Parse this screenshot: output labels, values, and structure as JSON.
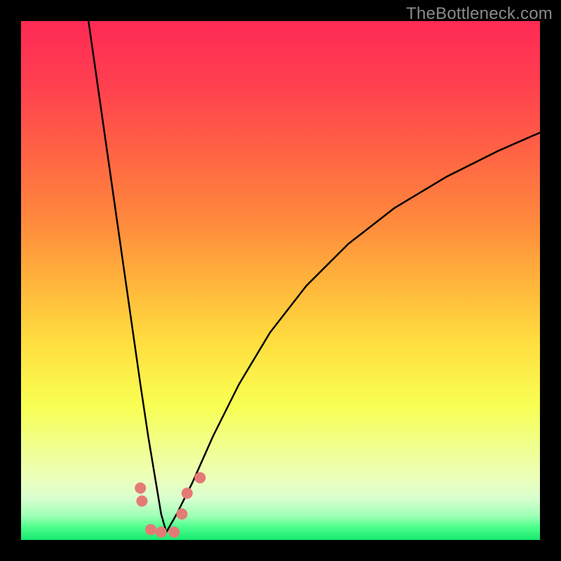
{
  "watermark": "TheBottleneck.com",
  "colors": {
    "black": "#000000",
    "curve": "#000000",
    "dot": "#e47a76",
    "gradient_stops": [
      {
        "offset": 0.0,
        "color": "#ff2a55"
      },
      {
        "offset": 0.12,
        "color": "#ff3f4f"
      },
      {
        "offset": 0.25,
        "color": "#ff6244"
      },
      {
        "offset": 0.38,
        "color": "#ff873d"
      },
      {
        "offset": 0.5,
        "color": "#ffb33b"
      },
      {
        "offset": 0.62,
        "color": "#ffde3f"
      },
      {
        "offset": 0.74,
        "color": "#f8ff52"
      },
      {
        "offset": 0.82,
        "color": "#f1ff8e"
      },
      {
        "offset": 0.88,
        "color": "#ecffba"
      },
      {
        "offset": 0.92,
        "color": "#d9ffd0"
      },
      {
        "offset": 0.955,
        "color": "#9bffb3"
      },
      {
        "offset": 0.975,
        "color": "#4dff8c"
      },
      {
        "offset": 1.0,
        "color": "#17e86e"
      }
    ]
  },
  "chart_data": {
    "type": "line",
    "title": "",
    "xlabel": "",
    "ylabel": "",
    "xlim": [
      0,
      100
    ],
    "ylim": [
      0,
      100
    ],
    "note": "V-shaped bottleneck curve; y represents mismatch/bottleneck severity (lower is better, minimum near x≈28).",
    "series": [
      {
        "name": "left_branch",
        "x": [
          13,
          15,
          17,
          19,
          21,
          23,
          24.5,
          26,
          27,
          28
        ],
        "y": [
          100,
          86,
          72,
          58,
          44,
          30,
          20,
          11,
          5,
          1.5
        ]
      },
      {
        "name": "right_branch",
        "x": [
          28,
          30,
          33,
          37,
          42,
          48,
          55,
          63,
          72,
          82,
          92,
          100
        ],
        "y": [
          1.5,
          5,
          11,
          20,
          30,
          40,
          49,
          57,
          64,
          70,
          75,
          78.5
        ]
      }
    ],
    "markers": [
      {
        "name": "left-cluster-upper",
        "x": 23.0,
        "y": 10.0
      },
      {
        "name": "left-cluster-lower",
        "x": 23.3,
        "y": 7.5
      },
      {
        "name": "floor-dot-1",
        "x": 25.0,
        "y": 2.0
      },
      {
        "name": "floor-dot-2",
        "x": 27.0,
        "y": 1.5
      },
      {
        "name": "floor-dot-3",
        "x": 29.5,
        "y": 1.5
      },
      {
        "name": "right-dot-lower",
        "x": 31.0,
        "y": 5.0
      },
      {
        "name": "right-dot-upper",
        "x": 32.0,
        "y": 9.0
      },
      {
        "name": "right-dot-far",
        "x": 34.5,
        "y": 12.0
      }
    ]
  }
}
